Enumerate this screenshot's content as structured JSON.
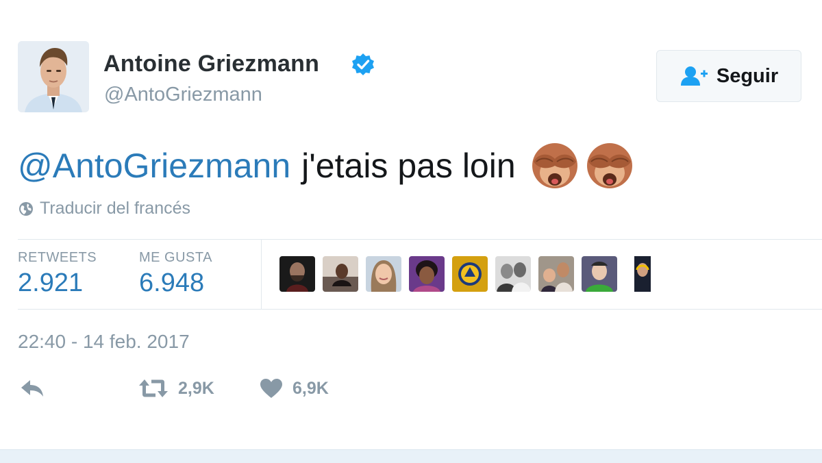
{
  "user": {
    "name": "Antoine Griezmann",
    "handle": "@AntoGriezmann",
    "verified": true
  },
  "follow_button": {
    "label": "Seguir"
  },
  "tweet": {
    "mention": "@AntoGriezmann",
    "text": "j'etais pas loin",
    "emojis": [
      "see-no-evil-monkey-icon",
      "see-no-evil-monkey-icon"
    ]
  },
  "translate": {
    "label": "Traducir del francés"
  },
  "stats": {
    "retweets_label": "RETWEETS",
    "retweets_value": "2.921",
    "likes_label": "ME GUSTA",
    "likes_value": "6.948"
  },
  "timestamp": "22:40 - 14 feb. 2017",
  "actions": {
    "reply_icon": "reply-icon",
    "retweet_count": "2,9K",
    "like_count": "6,9K"
  },
  "colors": {
    "link": "#2b7bb9",
    "muted": "#8899a6",
    "verified": "#1da1f2"
  }
}
